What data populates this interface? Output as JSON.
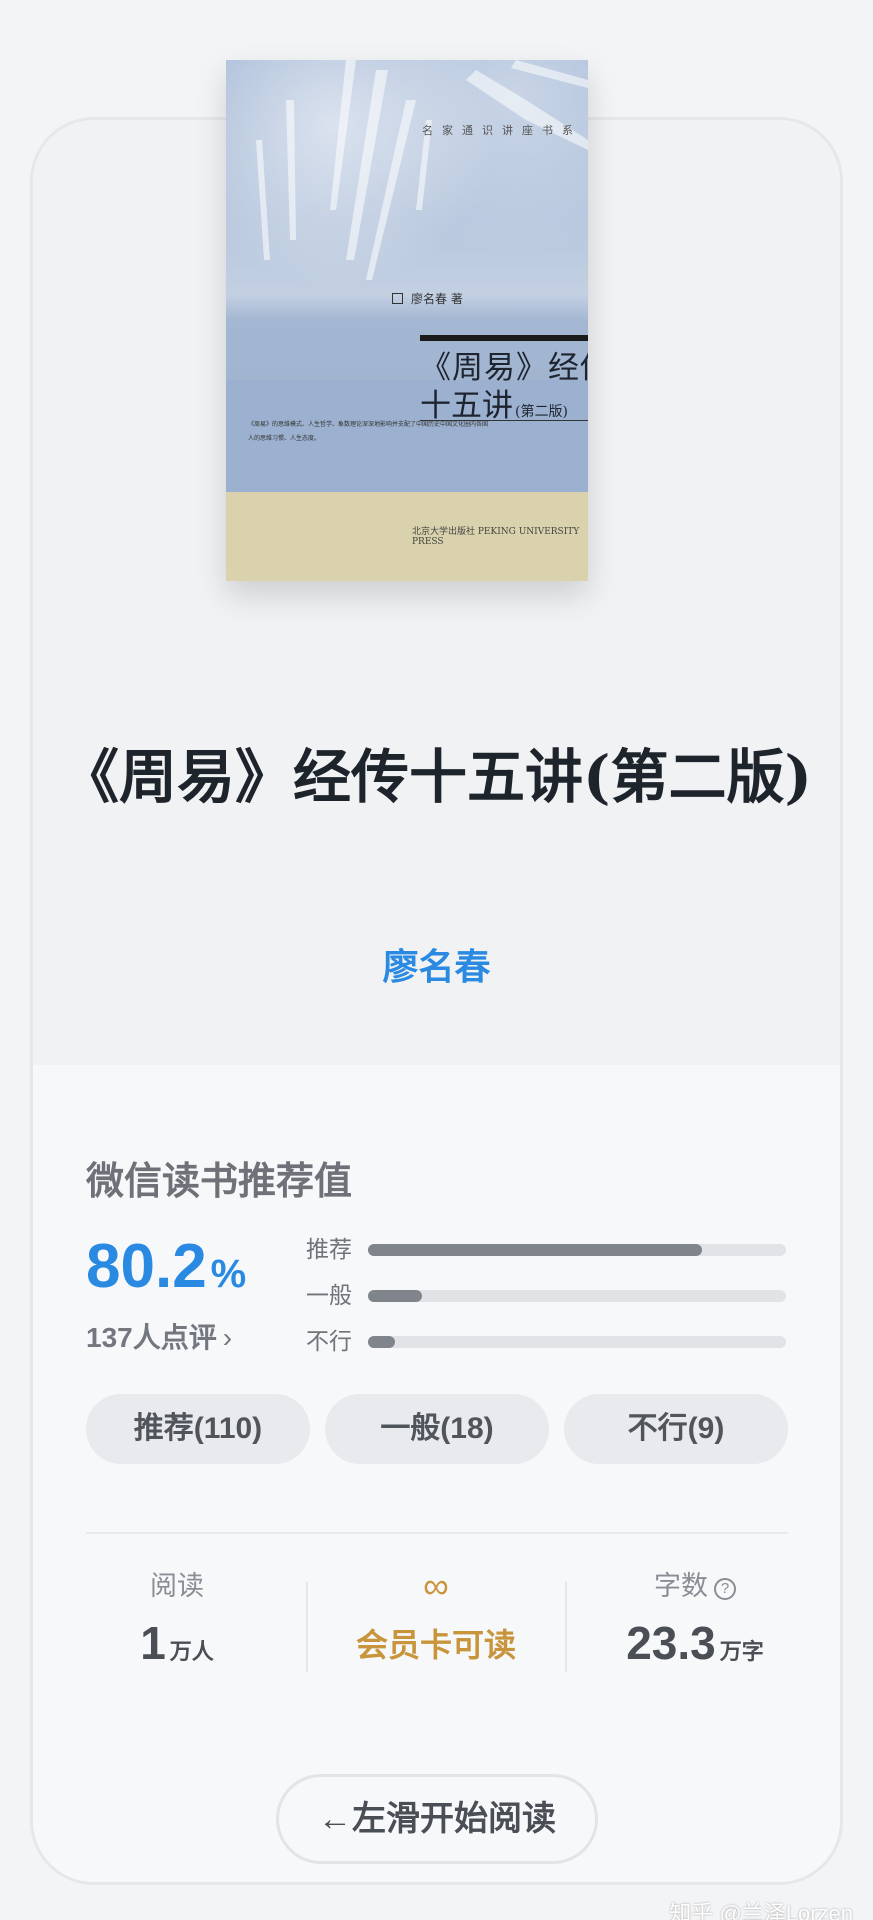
{
  "cover": {
    "series": "名家通识讲座书系",
    "author_line": "廖名春 著",
    "title_line1": "《周易》经传",
    "title_line2": "十五讲",
    "edition": "(第二版)",
    "blurb": "《周易》的思维模式、人生哲学、象数理论深深地影响并支配了中国历史中国文化圈内各国人的思维习惯、人生态度。",
    "publisher": "北京大学出版社 PEKING UNIVERSITY PRESS"
  },
  "book": {
    "title": "《周易》经传十五讲(第二版)",
    "author": "廖名春"
  },
  "rating": {
    "heading": "微信读书推荐值",
    "score": "80.2",
    "percent_sign": "%",
    "reviews": "137人点评",
    "reviews_chevron": "›",
    "bars": [
      {
        "label": "推荐",
        "fraction": 0.8
      },
      {
        "label": "一般",
        "fraction": 0.13
      },
      {
        "label": "不行",
        "fraction": 0.065
      }
    ],
    "buttons": [
      {
        "label": "推荐(110)"
      },
      {
        "label": "一般(18)"
      },
      {
        "label": "不行(9)"
      }
    ]
  },
  "stats": {
    "readers_label": "阅读",
    "readers_value": "1",
    "readers_unit": "万人",
    "member_icon": "∞",
    "member_label": "会员卡可读",
    "words_label": "字数",
    "words_help_icon": "?",
    "words_value": "23.3",
    "words_unit": "万字"
  },
  "start_button": "←左滑开始阅读",
  "watermark": "知乎 @兰泽Lorzen",
  "colors": {
    "accent": "#2a8ae2",
    "gold": "#c8953c"
  }
}
